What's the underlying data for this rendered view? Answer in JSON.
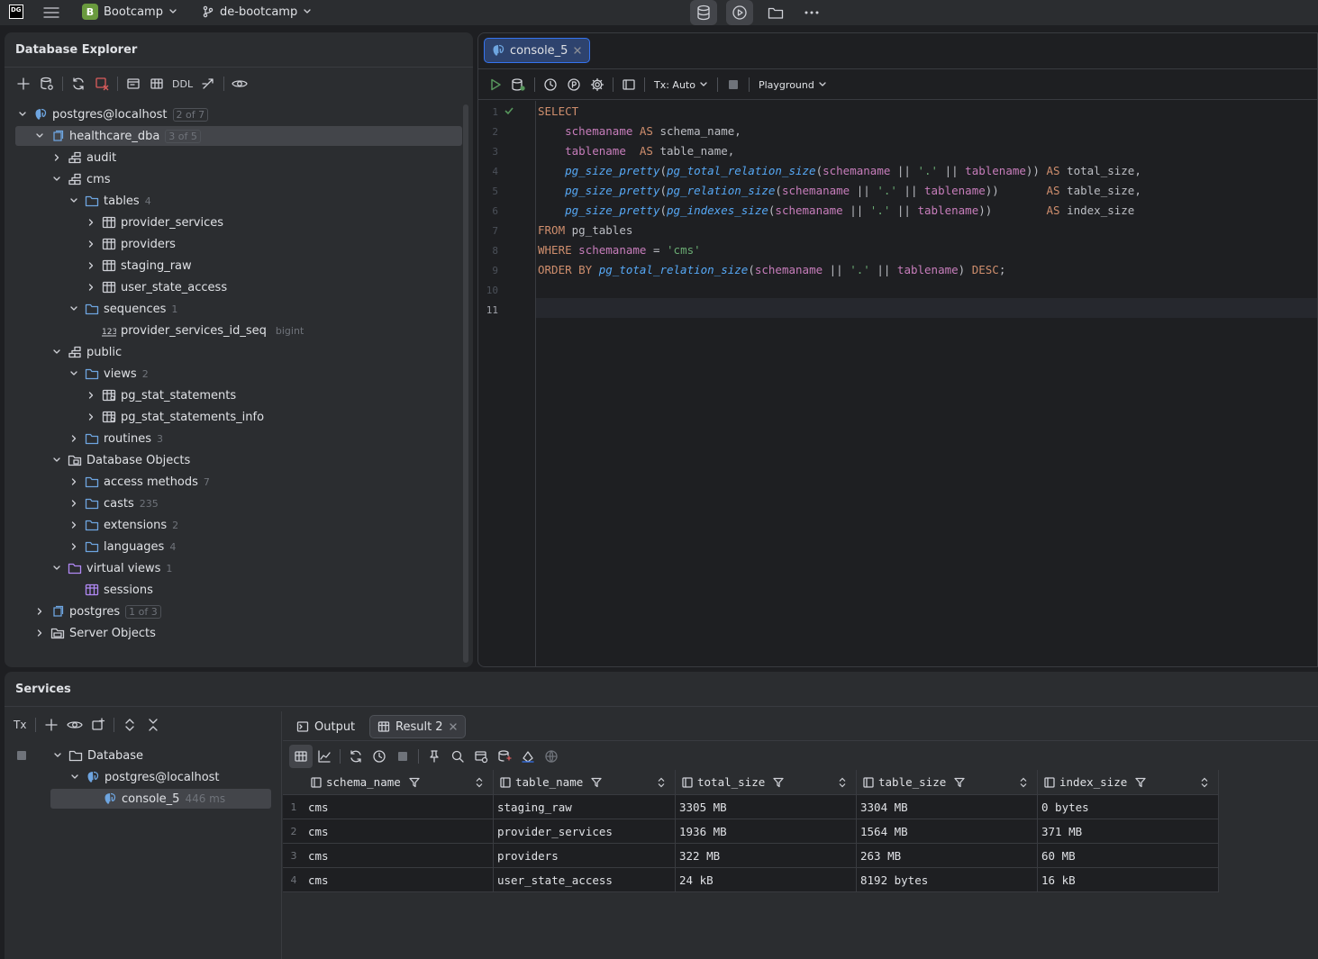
{
  "topbar": {
    "project_badge": "B",
    "project_name": "Bootcamp",
    "branch": "de-bootcamp"
  },
  "db_explorer": {
    "title": "Database Explorer",
    "ddl_label": "DDL",
    "tree": [
      {
        "label": "postgres@localhost",
        "badge": "2 of 7"
      },
      {
        "label": "healthcare_dba",
        "badge": "3 of 5"
      },
      {
        "label": "audit"
      },
      {
        "label": "cms"
      },
      {
        "label": "tables",
        "count": "4"
      },
      {
        "label": "provider_services"
      },
      {
        "label": "providers"
      },
      {
        "label": "staging_raw"
      },
      {
        "label": "user_state_access"
      },
      {
        "label": "sequences",
        "count": "1"
      },
      {
        "label": "provider_services_id_seq",
        "type": "bigint"
      },
      {
        "label": "public"
      },
      {
        "label": "views",
        "count": "2"
      },
      {
        "label": "pg_stat_statements"
      },
      {
        "label": "pg_stat_statements_info"
      },
      {
        "label": "routines",
        "count": "3"
      },
      {
        "label": "Database Objects"
      },
      {
        "label": "access methods",
        "count": "7"
      },
      {
        "label": "casts",
        "count": "235"
      },
      {
        "label": "extensions",
        "count": "2"
      },
      {
        "label": "languages",
        "count": "4"
      },
      {
        "label": "virtual views",
        "count": "1"
      },
      {
        "label": "sessions"
      },
      {
        "label": "postgres",
        "badge": "1 of 3"
      },
      {
        "label": "Server Objects"
      }
    ]
  },
  "editor": {
    "tab": "console_5",
    "tx_mode": "Tx: Auto",
    "mode": "Playground",
    "line_numbers": [
      "1",
      "2",
      "3",
      "4",
      "5",
      "6",
      "7",
      "8",
      "9",
      "10",
      "11"
    ]
  },
  "services": {
    "title": "Services",
    "tx_label": "Tx",
    "tree": {
      "root": "Database",
      "connection": "postgres@localhost",
      "console": "console_5",
      "console_time": "446 ms"
    },
    "tabs": {
      "output": "Output",
      "result": "Result 2"
    },
    "columns": [
      "schema_name",
      "table_name",
      "total_size",
      "table_size",
      "index_size"
    ],
    "rows": [
      {
        "n": "1",
        "cells": [
          "cms",
          "staging_raw",
          "3305 MB",
          "3304 MB",
          "0 bytes"
        ]
      },
      {
        "n": "2",
        "cells": [
          "cms",
          "provider_services",
          "1936 MB",
          "1564 MB",
          "371 MB"
        ]
      },
      {
        "n": "3",
        "cells": [
          "cms",
          "providers",
          "322 MB",
          "263 MB",
          "60 MB"
        ]
      },
      {
        "n": "4",
        "cells": [
          "cms",
          "user_state_access",
          "24 kB",
          "8192 bytes",
          "16 kB"
        ]
      }
    ]
  }
}
